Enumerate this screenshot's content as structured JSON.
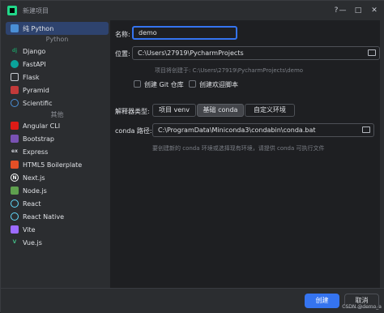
{
  "window": {
    "title": "新建项目"
  },
  "titlebar_buttons": {
    "help": "?",
    "minimize": "—",
    "maximize": "□",
    "close": "✕"
  },
  "sidebar": {
    "items": [
      {
        "label": "纯 Python",
        "icon": "python-icon",
        "color": "#4a8fd6"
      },
      {
        "label": "Django",
        "icon": "django-icon",
        "color": "#1f8f5f"
      },
      {
        "label": "FastAPI",
        "icon": "fastapi-icon",
        "color": "#0aa39b"
      },
      {
        "label": "Flask",
        "icon": "flask-icon",
        "color": "#c9ccd3"
      },
      {
        "label": "Pyramid",
        "icon": "pyramid-icon",
        "color": "#c23a3a"
      },
      {
        "label": "Scientific",
        "icon": "scientific-icon",
        "color": "#4a8fd6"
      },
      {
        "label": "Angular CLI",
        "icon": "angular-icon",
        "color": "#dd1b16"
      },
      {
        "label": "Bootstrap",
        "icon": "bootstrap-icon",
        "color": "#7952b3"
      },
      {
        "label": "Express",
        "icon": "express-icon",
        "color": "#c9ccd3"
      },
      {
        "label": "HTML5 Boilerplate",
        "icon": "html5-icon",
        "color": "#e34f26"
      },
      {
        "label": "Next.js",
        "icon": "nextjs-icon",
        "color": "#ffffff"
      },
      {
        "label": "Node.js",
        "icon": "nodejs-icon",
        "color": "#5fa04e"
      },
      {
        "label": "React",
        "icon": "react-icon",
        "color": "#61dafb"
      },
      {
        "label": "React Native",
        "icon": "react-native-icon",
        "color": "#61dafb"
      },
      {
        "label": "Vite",
        "icon": "vite-icon",
        "color": "#9c6bff"
      },
      {
        "label": "Vue.js",
        "icon": "vue-icon",
        "color": "#42b883"
      }
    ],
    "heading_python": "Python",
    "heading_other": "其他"
  },
  "form": {
    "name_label": "名称:",
    "name_value": "demo",
    "location_label": "位置:",
    "location_value": "C:\\Users\\27919\\PycharmProjects",
    "location_hint": "项目将创建于: C:\\Users\\27919\\PycharmProjects\\demo",
    "git_label": "创建 Git 仓库",
    "welcome_label": "创建欢迎脚本",
    "interpreter_label": "解释器类型:",
    "interpreter_options": [
      "项目 venv",
      "基础 conda",
      "自定义环境"
    ],
    "conda_label": "conda 路径:",
    "conda_value": "C:\\ProgramData\\Miniconda3\\condabin\\conda.bat",
    "conda_hint": "要创建新的 conda 环境或选择现有环境，请提供 conda 可执行文件"
  },
  "footer": {
    "create_label": "创建",
    "cancel_label": "取消",
    "watermark": "CSDN @demo_a"
  },
  "colors": {
    "accent": "#3574f0",
    "selected": "#2e436e"
  }
}
